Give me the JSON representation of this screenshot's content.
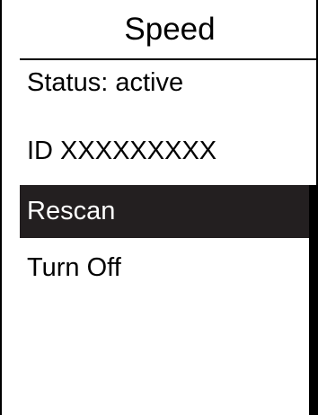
{
  "screen": {
    "title": "Speed",
    "status": "Status: active",
    "device_id": "ID XXXXXXXXX"
  },
  "menu": {
    "items": [
      {
        "label": "Rescan",
        "selected": true
      },
      {
        "label": "Turn Off",
        "selected": false
      }
    ]
  },
  "scrollbar": {
    "visible_fraction": 1.0
  },
  "colors": {
    "selection_background": "#231f20",
    "selection_text": "#ffffff",
    "foreground": "#000000",
    "background": "#ffffff"
  }
}
